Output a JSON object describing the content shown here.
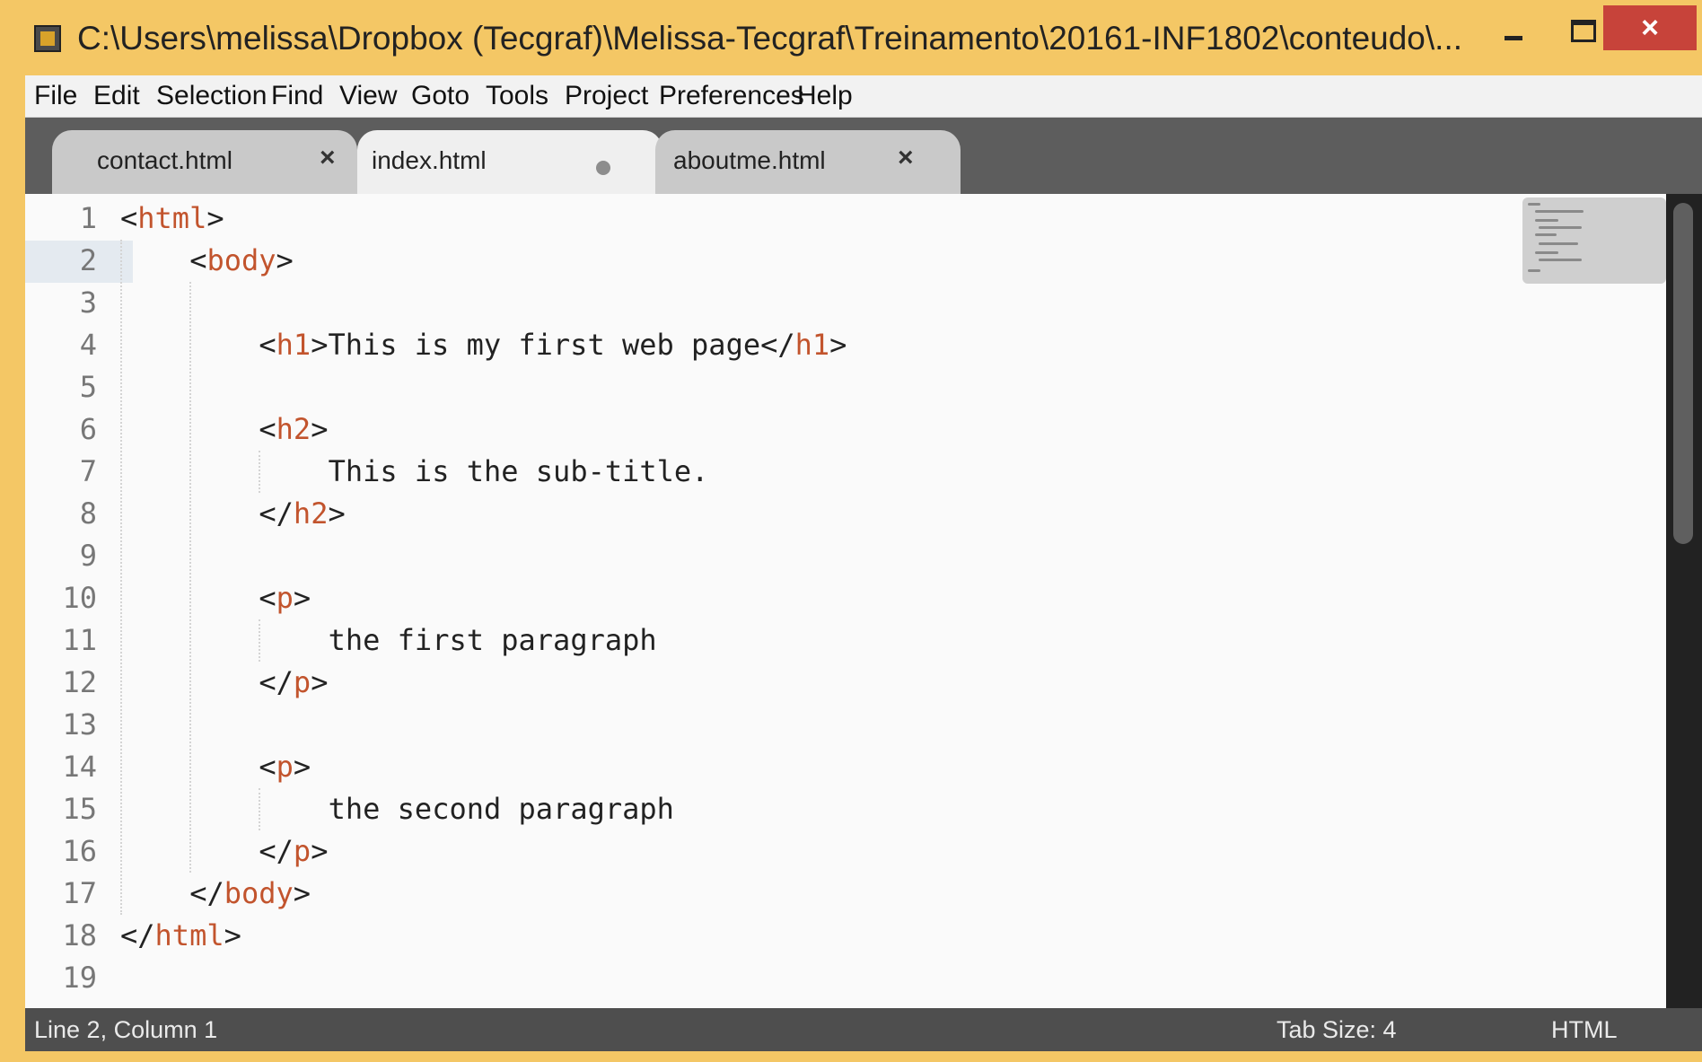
{
  "window": {
    "title": "C:\\Users\\melissa\\Dropbox (Tecgraf)\\Melissa-Tecgraf\\Treinamento\\20161-INF1802\\conteudo\\...",
    "minimize_glyph": "",
    "maximize_glyph": "",
    "close_glyph": "×"
  },
  "menu": {
    "items": [
      "File",
      "Edit",
      "Selection",
      "Find",
      "View",
      "Goto",
      "Tools",
      "Project",
      "Preferences",
      "Help"
    ]
  },
  "tabs": [
    {
      "label": "contact.html",
      "state": "inactive",
      "close": "×"
    },
    {
      "label": "index.html",
      "state": "active-unsaved"
    },
    {
      "label": "aboutme.html",
      "state": "inactive",
      "close": "×"
    }
  ],
  "editor": {
    "line_numbers": [
      "1",
      "2",
      "3",
      "4",
      "5",
      "6",
      "7",
      "8",
      "9",
      "10",
      "11",
      "12",
      "13",
      "14",
      "15",
      "16",
      "17",
      "18",
      "19"
    ],
    "lines": [
      {
        "indent": 0,
        "parts": [
          [
            "punct",
            "<"
          ],
          [
            "tag",
            "html"
          ],
          [
            "punct",
            ">"
          ]
        ]
      },
      {
        "indent": 1,
        "parts": [
          [
            "punct",
            "<"
          ],
          [
            "tag",
            "body"
          ],
          [
            "punct",
            ">"
          ]
        ]
      },
      {
        "indent": 0,
        "parts": []
      },
      {
        "indent": 2,
        "parts": [
          [
            "punct",
            "<"
          ],
          [
            "tag",
            "h1"
          ],
          [
            "punct",
            ">This is my first web page</"
          ],
          [
            "tag",
            "h1"
          ],
          [
            "punct",
            ">"
          ]
        ]
      },
      {
        "indent": 0,
        "parts": []
      },
      {
        "indent": 2,
        "parts": [
          [
            "punct",
            "<"
          ],
          [
            "tag",
            "h2"
          ],
          [
            "punct",
            ">"
          ]
        ]
      },
      {
        "indent": 3,
        "parts": [
          [
            "punct",
            "This is the sub-title."
          ]
        ]
      },
      {
        "indent": 2,
        "parts": [
          [
            "punct",
            "</"
          ],
          [
            "tag",
            "h2"
          ],
          [
            "punct",
            ">"
          ]
        ]
      },
      {
        "indent": 0,
        "parts": []
      },
      {
        "indent": 2,
        "parts": [
          [
            "punct",
            "<"
          ],
          [
            "tag",
            "p"
          ],
          [
            "punct",
            ">"
          ]
        ]
      },
      {
        "indent": 3,
        "parts": [
          [
            "punct",
            "the first paragraph"
          ]
        ]
      },
      {
        "indent": 2,
        "parts": [
          [
            "punct",
            "</"
          ],
          [
            "tag",
            "p"
          ],
          [
            "punct",
            ">"
          ]
        ]
      },
      {
        "indent": 0,
        "parts": []
      },
      {
        "indent": 2,
        "parts": [
          [
            "punct",
            "<"
          ],
          [
            "tag",
            "p"
          ],
          [
            "punct",
            ">"
          ]
        ]
      },
      {
        "indent": 3,
        "parts": [
          [
            "punct",
            "the second paragraph"
          ]
        ]
      },
      {
        "indent": 2,
        "parts": [
          [
            "punct",
            "</"
          ],
          [
            "tag",
            "p"
          ],
          [
            "punct",
            ">"
          ]
        ]
      },
      {
        "indent": 1,
        "parts": [
          [
            "punct",
            "</"
          ],
          [
            "tag",
            "body"
          ],
          [
            "punct",
            ">"
          ]
        ]
      },
      {
        "indent": 0,
        "parts": [
          [
            "punct",
            "</"
          ],
          [
            "tag",
            "html"
          ],
          [
            "punct",
            ">"
          ]
        ]
      },
      {
        "indent": 0,
        "parts": []
      }
    ],
    "current_line": 2
  },
  "status": {
    "position": "Line 2, Column 1",
    "tab_size": "Tab Size: 4",
    "syntax": "HTML"
  },
  "colors": {
    "window_frame": "#f4c765",
    "close_button": "#c7433a",
    "tag": "#c2542d",
    "status_bg": "#4e4e4e"
  }
}
